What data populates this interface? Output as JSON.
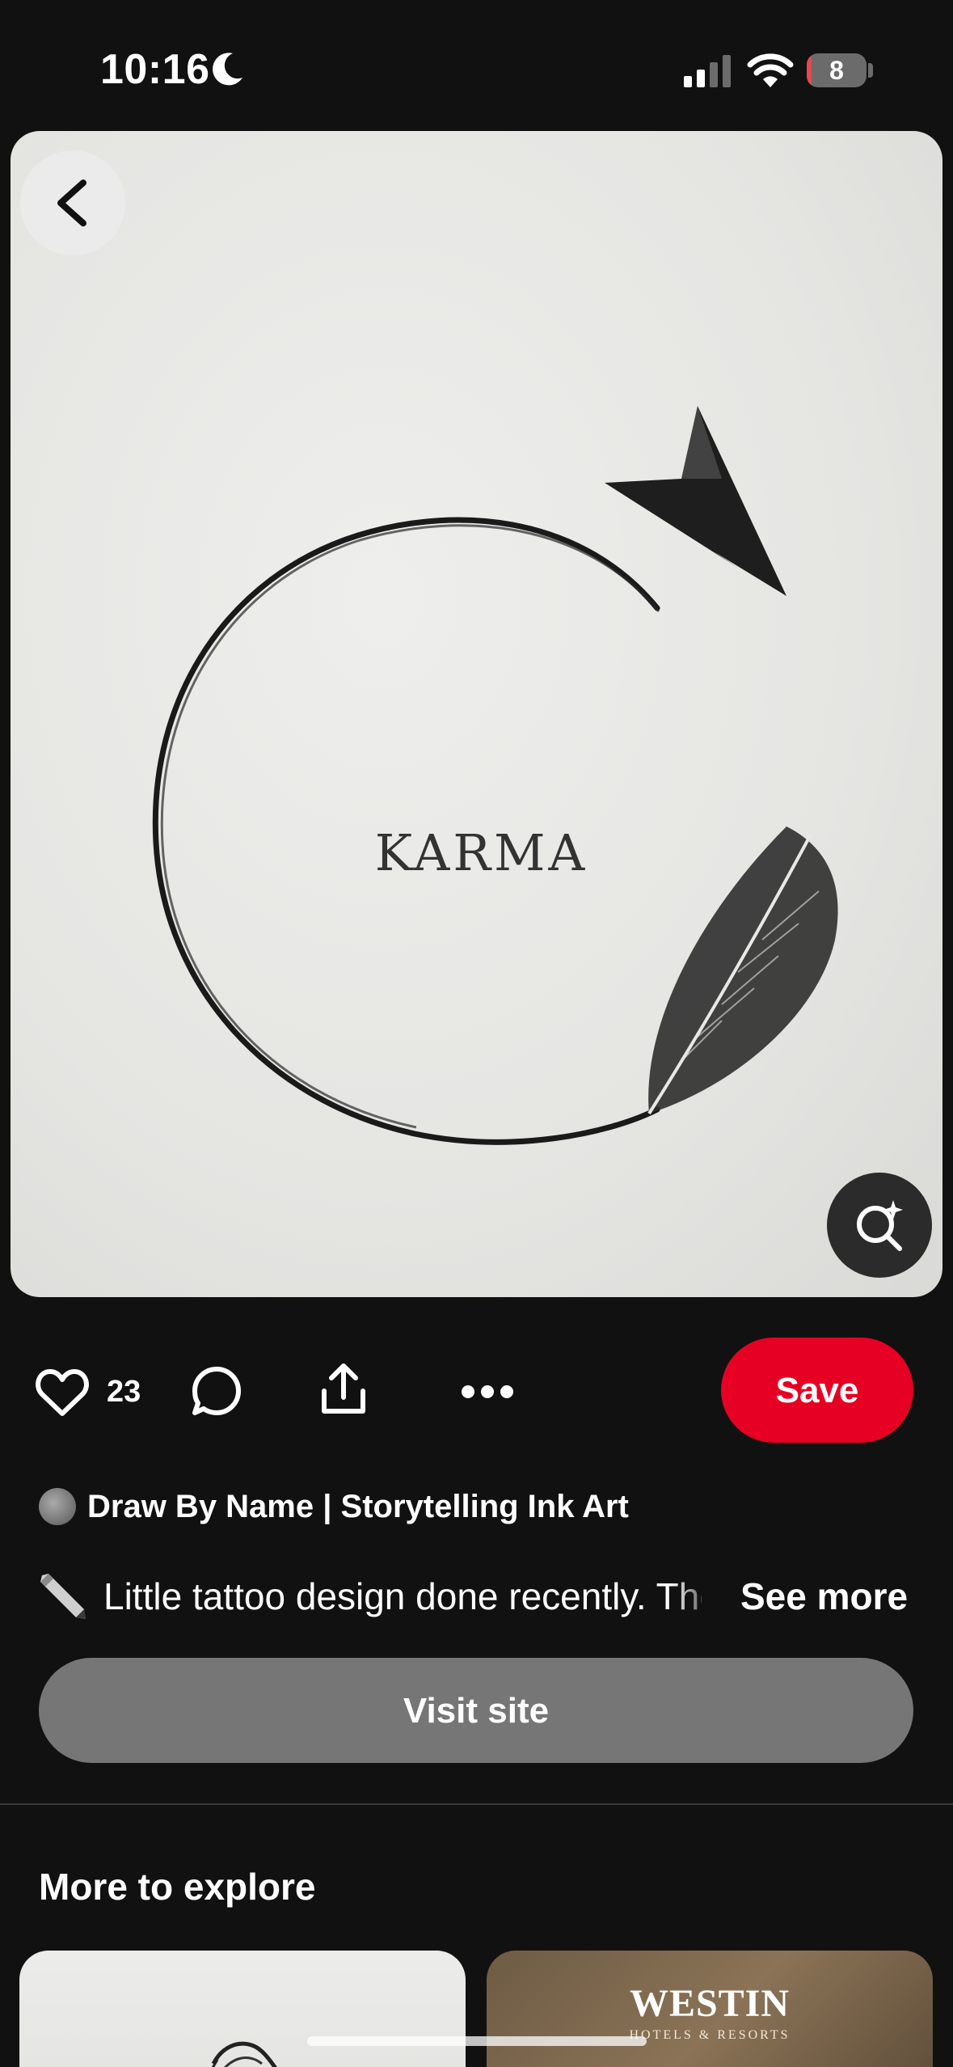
{
  "status_bar": {
    "time": "10:16",
    "battery_level": "8",
    "battery_fraction": 0.08,
    "signal_bars_active": 2,
    "signal_bars_total": 4
  },
  "pin": {
    "image_text": "KARMA",
    "like_count": "23",
    "save_label": "Save",
    "creator_name": "Draw By Name | Storytelling Ink Art",
    "description": "Little tattoo design done recently. The",
    "see_more_label": "See more",
    "visit_label": "Visit site"
  },
  "explore": {
    "title": "More to explore",
    "cards": [
      {
        "logo": ""
      },
      {
        "logo": "WESTIN",
        "subtitle": "HOTELS & RESORTS"
      }
    ]
  },
  "colors": {
    "background": "#111111",
    "save_button": "#e60023",
    "visit_button": "#767676",
    "battery_low": "#e5484d"
  },
  "icons": {
    "moon": "moon-icon",
    "signal": "cellular-signal-icon",
    "wifi": "wifi-icon",
    "battery": "battery-icon",
    "back": "chevron-left-icon",
    "visual_search": "visual-search-icon",
    "like": "heart-icon",
    "comment": "comment-icon",
    "share": "share-icon",
    "more": "more-options-icon",
    "pen": "pen-icon"
  }
}
